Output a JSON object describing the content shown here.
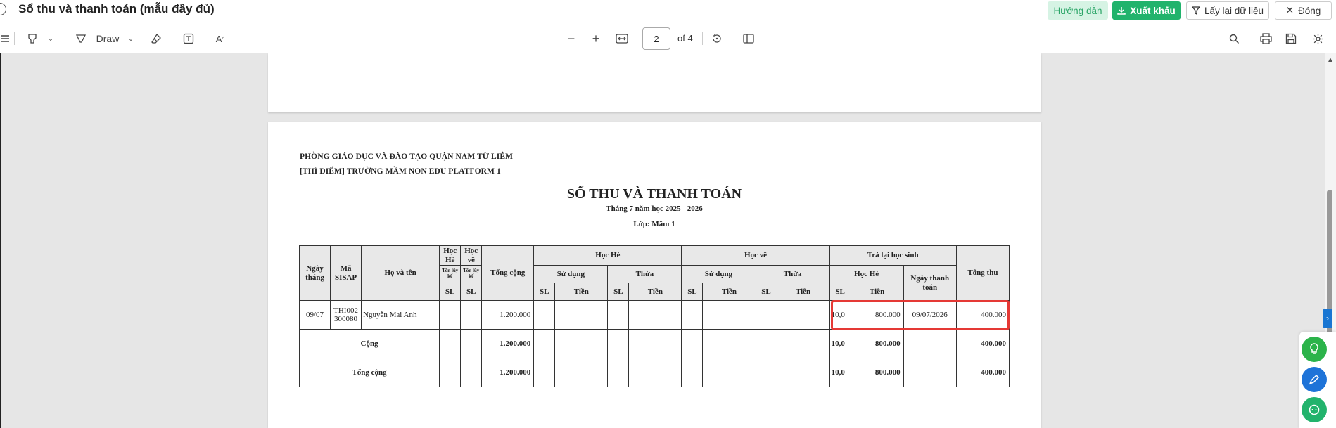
{
  "header": {
    "title": "Sổ thu và thanh toán (mẫu đầy đủ)",
    "guide_label": "Hướng dẫn",
    "export_label": "Xuất khẩu",
    "reload_label": "Lấy lại dữ liệu",
    "close_label": "Đóng"
  },
  "toolbar": {
    "draw_label": "Draw",
    "page_value": "2",
    "page_of": "of 4"
  },
  "report": {
    "org_line1": "PHÒNG GIÁO DỤC VÀ ĐÀO TẠO QUẬN NAM TỪ LIÊM",
    "org_line2": "[THÍ ĐIỂM] TRƯỜNG MẦM NON EDU PLATFORM 1",
    "title": "SỔ THU VÀ THANH TOÁN",
    "subtitle": "Tháng 7 năm học 2025 - 2026",
    "class_label": "Lớp: Mầm 1",
    "headers": {
      "date": "Ngày tháng",
      "sisap": "Mã SISAP",
      "name": "Họ và tên",
      "hoc_he": "Học Hè",
      "hoc_ve": "Học về",
      "ton_luy_ke": "Tồn lũy kế",
      "sl": "SL",
      "tong_cong": "Tổng cộng",
      "hoc_he_group": "Học Hè",
      "hoc_ve_group": "Học về",
      "tra_lai": "Trả lại học sinh",
      "su_dung": "Sử dụng",
      "thua": "Thừa",
      "tien": "Tiền",
      "tra_hoc_he": "Học Hè",
      "ngay_thanh_toan": "Ngày thanh toán",
      "tong_thu": "Tổng thu"
    },
    "row": {
      "date": "09/07",
      "sisap": "THI002 300080",
      "name": "Nguyễn Mai Anh",
      "tong_cong": "1.200.000",
      "tra_sl": "10,0",
      "tra_tien": "800.000",
      "ngay_tt": "09/07/2026",
      "tong_thu": "400.000"
    },
    "cong": {
      "label": "Cộng",
      "tong_cong": "1.200.000",
      "tra_sl": "10,0",
      "tra_tien": "800.000",
      "tong_thu": "400.000"
    },
    "total": {
      "label": "Tổng cộng",
      "tong_cong": "1.200.000",
      "tra_sl": "10,0",
      "tra_tien": "800.000",
      "tong_thu": "400.000"
    }
  },
  "colors": {
    "accent_green": "#21b36c",
    "highlight_red": "#e53935",
    "side_blue": "#1976d2"
  }
}
